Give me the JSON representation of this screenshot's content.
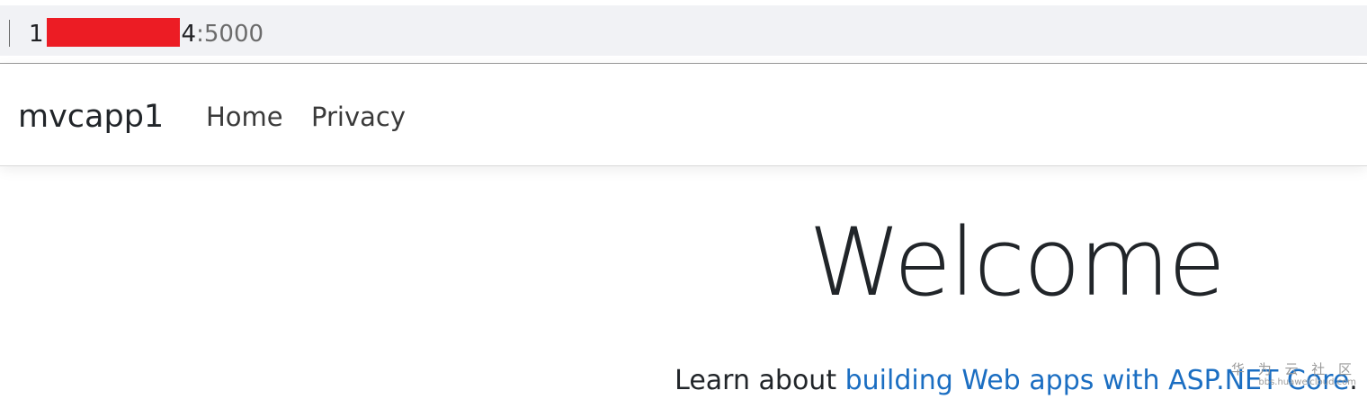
{
  "address_bar": {
    "url_prefix": "1",
    "url_suffix": "4",
    "port": ":5000"
  },
  "navbar": {
    "brand": "mvcapp1",
    "links": [
      "Home",
      "Privacy"
    ]
  },
  "main": {
    "heading": "Welcome",
    "learn_prefix": "Learn about ",
    "learn_link": "building Web apps with ASP.NET Core",
    "learn_suffix": "."
  },
  "watermark": {
    "text": "华 为 云 社 区",
    "url": "bbs.huaweicloud.com"
  },
  "colors": {
    "link": "#1b6ec2",
    "redaction": "#ec1c24",
    "address_bar_bg": "#f1f2f5"
  }
}
